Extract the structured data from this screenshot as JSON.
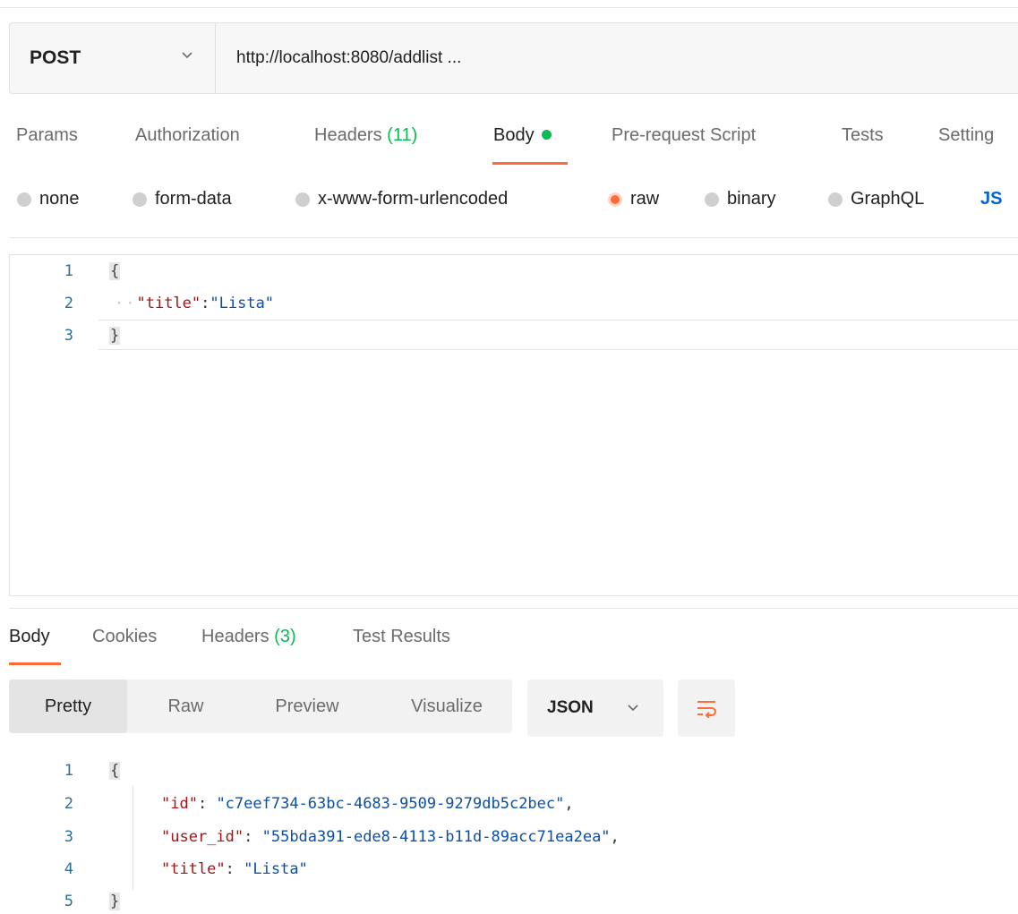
{
  "request": {
    "method": "POST",
    "url": "http://localhost:8080/addlist ..."
  },
  "request_tabs": {
    "params": "Params",
    "authorization": "Authorization",
    "headers_label": "Headers",
    "headers_count": "(11)",
    "body": "Body",
    "pre_request": "Pre-request Script",
    "tests": "Tests",
    "settings": "Setting"
  },
  "body_types": {
    "none": "none",
    "form_data": "form-data",
    "urlencoded": "x-www-form-urlencoded",
    "raw": "raw",
    "binary": "binary",
    "graphql": "GraphQL",
    "json": "JS",
    "selected": "raw"
  },
  "request_body": {
    "line_numbers": [
      "1",
      "2",
      "3"
    ],
    "open_brace": "{",
    "indent": "··",
    "key": "\"title\"",
    "colon": ":",
    "value": "\"Lista\"",
    "close_brace": "}"
  },
  "response_tabs": {
    "body": "Body",
    "cookies": "Cookies",
    "headers_label": "Headers",
    "headers_count": "(3)",
    "test_results": "Test Results"
  },
  "response_view": {
    "pretty": "Pretty",
    "raw": "Raw",
    "preview": "Preview",
    "visualize": "Visualize",
    "format": "JSON"
  },
  "response_body": {
    "line_numbers": [
      "1",
      "2",
      "3",
      "4",
      "5"
    ],
    "open_brace": "{",
    "close_brace": "}",
    "id_key": "\"id\"",
    "id_value": "\"c7eef734-63bc-4683-9509-9279db5c2bec\"",
    "user_id_key": "\"user_id\"",
    "user_id_value": "\"55bda391-ede8-4113-b11d-89acc71ea2ea\"",
    "title_key": "\"title\"",
    "title_value": "\"Lista\"",
    "colon_space": ": ",
    "comma": ","
  },
  "colors": {
    "accent": "#ff6c37",
    "success": "#0cbb52",
    "link": "#0265d2"
  }
}
